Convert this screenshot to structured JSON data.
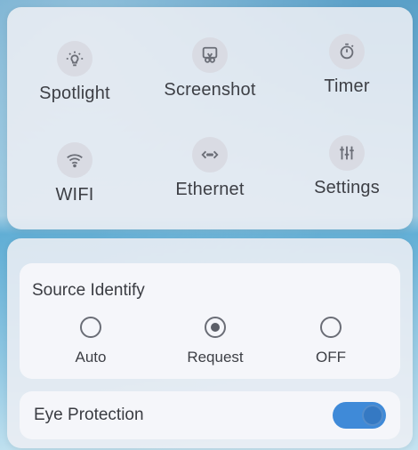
{
  "quick_tiles": [
    {
      "label": "Spotlight",
      "icon": "bulb-icon"
    },
    {
      "label": "Screenshot",
      "icon": "scissors-icon"
    },
    {
      "label": "Timer",
      "icon": "timer-icon"
    },
    {
      "label": "WIFI",
      "icon": "wifi-icon"
    },
    {
      "label": "Ethernet",
      "icon": "ethernet-icon"
    },
    {
      "label": "Settings",
      "icon": "sliders-icon"
    }
  ],
  "source_identify": {
    "title": "Source Identify",
    "options": [
      "Auto",
      "Request",
      "OFF"
    ],
    "selected": "Request"
  },
  "eye_protection": {
    "label": "Eye Protection",
    "enabled": true
  },
  "colors": {
    "toggle_on": "#3f8ad8",
    "panel_bg": "#eceef4"
  }
}
